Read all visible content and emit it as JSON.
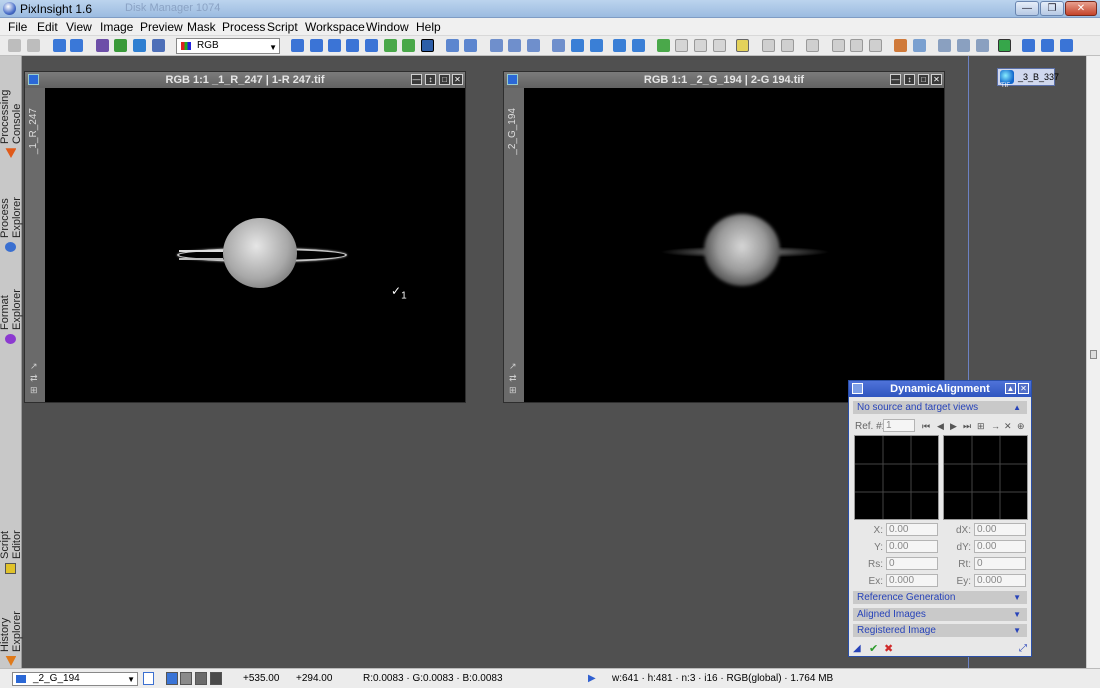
{
  "window": {
    "title": "PixInsight 1.6",
    "ghost_title": "Disk Manager 1074"
  },
  "menu": [
    "File",
    "Edit",
    "View",
    "Image",
    "Preview",
    "Mask",
    "Process",
    "Script",
    "Workspace",
    "Window",
    "Help"
  ],
  "toolbar": {
    "channel_select": "RGB"
  },
  "left_dock": {
    "tabs": [
      "Processing Console",
      "Process Explorer",
      "Format Explorer",
      "Script Editor",
      "History Explorer"
    ]
  },
  "image_windows": [
    {
      "title": "RGB 1:1 _1_R_247 | 1-R 247.tif",
      "side_label": "_1_R_247"
    },
    {
      "title": "RGB 1:1 _2_G_194 | 2-G 194.tif",
      "side_label": "_2_G_194"
    }
  ],
  "cursor_label": "1",
  "icons_panel": {
    "tif_label": "_3_B_337",
    "tif_badge": "TIF"
  },
  "dynamic_alignment": {
    "title": "DynamicAlignment",
    "status": "No source and target views",
    "ref_label": "Ref. #:",
    "ref_value": "1",
    "fields": {
      "x_label": "X:",
      "x": "0.00",
      "dx_label": "dX:",
      "dx": "0.00",
      "y_label": "Y:",
      "y": "0.00",
      "dy_label": "dY:",
      "dy": "0.00",
      "rs_label": "Rs:",
      "rs": "0",
      "rt_label": "Rt:",
      "rt": "0",
      "ex_label": "Ex:",
      "ex": "0.000",
      "ey_label": "Ey:",
      "ey": "0.000"
    },
    "sections": [
      "Reference Generation",
      "Aligned Images",
      "Registered Image"
    ]
  },
  "status_bar": {
    "view": "_2_G_194",
    "x": "+535.00",
    "y": "+294.00",
    "rgb": "R:0.0083 · G:0.0083 · B:0.0083",
    "info": "w:641 · h:481 · n:3 · i16 · RGB(global) · 1.764 MB"
  }
}
